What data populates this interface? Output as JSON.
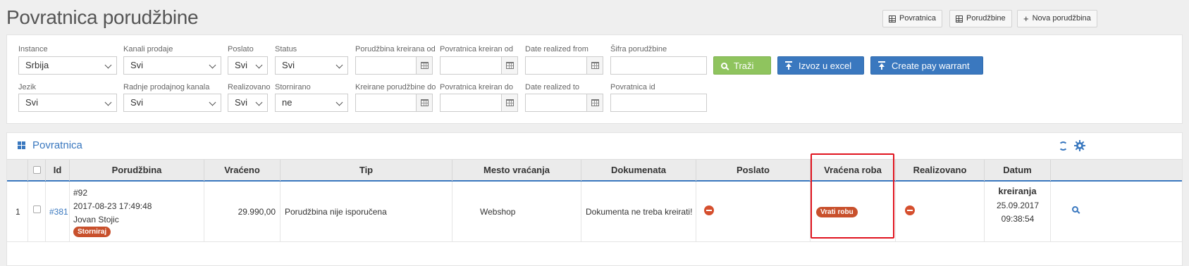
{
  "page_title": "Povratnica porudžbine",
  "top_buttons": [
    {
      "label": "Povratnica",
      "icon": "grid-icon"
    },
    {
      "label": "Porudžbine",
      "icon": "grid-icon"
    },
    {
      "label": "Nova porudžbina",
      "icon": "plus-icon"
    }
  ],
  "filters": {
    "instance": {
      "label": "Instance",
      "value": "Srbija"
    },
    "sales_channels": {
      "label": "Kanali prodaje",
      "value": "Svi"
    },
    "sent": {
      "label": "Poslato",
      "value": "Svi"
    },
    "status": {
      "label": "Status",
      "value": "Svi"
    },
    "order_created_from": {
      "label": "Porudžbina kreirana od",
      "value": ""
    },
    "return_created_from": {
      "label": "Povratnica kreiran od",
      "value": ""
    },
    "date_realized_from": {
      "label": "Date realized from",
      "value": ""
    },
    "order_code": {
      "label": "Šifra porudžbine",
      "value": ""
    },
    "language": {
      "label": "Jezik",
      "value": "Svi"
    },
    "channel_stores": {
      "label": "Radnje prodajnog kanala",
      "value": "Svi"
    },
    "realized": {
      "label": "Realizovano",
      "value": "Svi"
    },
    "cancelled": {
      "label": "Stornirano",
      "value": "ne"
    },
    "order_created_to": {
      "label": "Kreirane porudžbine do",
      "value": ""
    },
    "return_created_to": {
      "label": "Povratnica kreiran do",
      "value": ""
    },
    "date_realized_to": {
      "label": "Date realized to",
      "value": ""
    },
    "return_id": {
      "label": "Povratnica id",
      "value": ""
    }
  },
  "actions": {
    "search": "Traži",
    "export_excel": "Izvoz u excel",
    "pay_warrant": "Create pay warrant"
  },
  "table": {
    "title": "Povratnica",
    "columns": [
      "Id",
      "Porudžbina",
      "Vraćeno",
      "Tip",
      "Mesto vraćanja",
      "Dokumenata",
      "Poslato",
      "Vraćena roba",
      "Realizovano",
      "Datum kreiranja"
    ],
    "rows": [
      {
        "index": "1",
        "id": "#381",
        "order_number": "#92",
        "order_datetime": "2017-08-23 17:49:48",
        "customer": "Jovan Stojic",
        "storno_label": "Storniraj",
        "returned_amount": "29.990,00",
        "type": "Porudžbina nije isporučena",
        "return_place": "Webshop",
        "documents": "Dokumenta ne treba kreirati!",
        "sent_status": "minus-icon",
        "returned_goods_action": "Vrati robu",
        "realized_status": "minus-icon",
        "created_date": "25.09.2017",
        "created_time": "09:38:54"
      }
    ]
  },
  "colors": {
    "accent_blue": "#3a78bf",
    "green_button": "#8fc45e",
    "danger_red": "#d54f2e",
    "pill_orange": "#c8502c",
    "highlight_red": "#e0141f"
  }
}
